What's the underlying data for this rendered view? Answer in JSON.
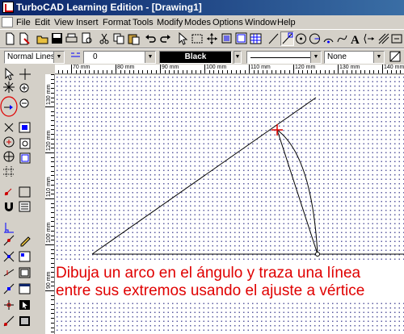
{
  "window": {
    "title": "TurboCAD Learning Edition - [Drawing1]"
  },
  "menu": [
    "File",
    "Edit",
    "View",
    "Insert",
    "Format",
    "Tools",
    "Modify",
    "Modes",
    "Options",
    "Window",
    "Help"
  ],
  "property_bar": {
    "line_style": "Normal Lines",
    "line_width": "0",
    "color": "Black",
    "fill": "None"
  },
  "ruler": {
    "horizontal": [
      "70 mm",
      "80 mm",
      "90 mm",
      "100 mm",
      "110 mm",
      "120 mm",
      "130 mm",
      "140 mm"
    ],
    "vertical": [
      "130 mm",
      "120 mm",
      "110 mm",
      "100 mm",
      "90 mm"
    ]
  },
  "caption": {
    "line1": "Dibuja un arco en el ángulo y traza una línea",
    "line2": "entre sus extremos usando el ajuste a vértice"
  },
  "colors": {
    "caption": "#e00000",
    "title_bar": "#0a246a",
    "snap_marker": "#e00000",
    "grid_dots": "#5a5aa0"
  }
}
